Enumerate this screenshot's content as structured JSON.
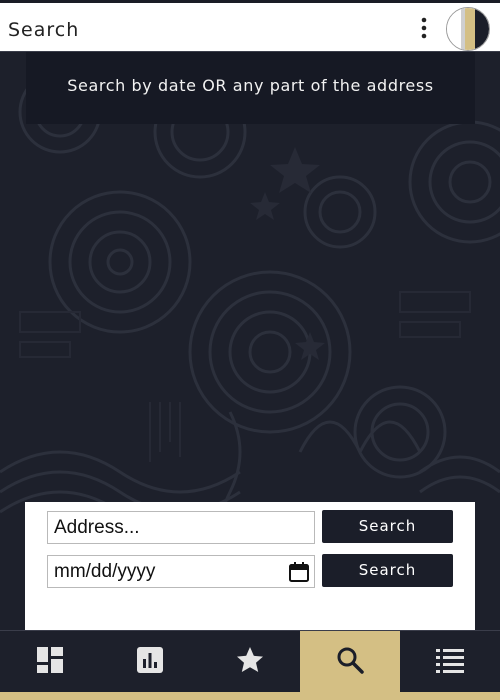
{
  "header": {
    "title": "Search",
    "menu_icon": "more-vert-icon",
    "avatar_icon": "avatar"
  },
  "banner": {
    "text": "Search by date OR any part of the address"
  },
  "search_panel": {
    "address_placeholder": "Address...",
    "address_value": "",
    "date_placeholder": "mm/dd/yyyy",
    "address_button": "Search",
    "date_button": "Search"
  },
  "bottom_nav": {
    "items": [
      {
        "icon": "dashboard-icon",
        "active": false
      },
      {
        "icon": "bar-chart-icon",
        "active": false
      },
      {
        "icon": "star-icon",
        "active": false
      },
      {
        "icon": "search-icon",
        "active": true
      },
      {
        "icon": "list-icon",
        "active": false
      }
    ]
  },
  "colors": {
    "background": "#1d202b",
    "banner": "#161924",
    "accent_gold": "#d4bf84",
    "button": "#1b1e29",
    "panel": "#ffffff"
  }
}
